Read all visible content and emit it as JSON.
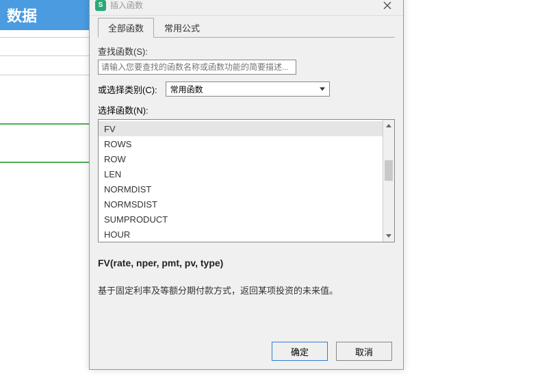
{
  "sheet": {
    "header": "数据"
  },
  "dialog": {
    "title": "插入函数",
    "tabs": [
      {
        "label": "全部函数",
        "active": true
      },
      {
        "label": "常用公式",
        "active": false
      }
    ],
    "search": {
      "label": "查找函数(S):",
      "placeholder": "请输入您要查找的函数名称或函数功能的简要描述..."
    },
    "category": {
      "label": "或选择类别(C):",
      "selected": "常用函数"
    },
    "list": {
      "label": "选择函数(N):",
      "items": [
        "FV",
        "ROWS",
        "ROW",
        "LEN",
        "NORMDIST",
        "NORMSDIST",
        "SUMPRODUCT",
        "HOUR"
      ],
      "selected_index": 0
    },
    "detail": {
      "signature": "FV(rate, nper, pmt, pv, type)",
      "description": "基于固定利率及等额分期付款方式，返回某项投资的未来值。"
    },
    "buttons": {
      "ok": "确定",
      "cancel": "取消"
    }
  }
}
